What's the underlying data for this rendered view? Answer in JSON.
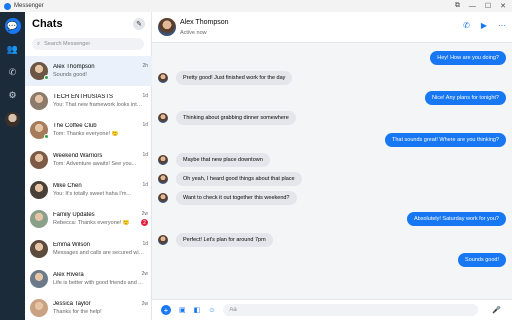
{
  "window": {
    "title": "Messenger",
    "controls": [
      "⧉",
      "—",
      "☐",
      "✕"
    ]
  },
  "sidebar": {
    "title": "Chats",
    "search_placeholder": "Search Messenger"
  },
  "chats": [
    {
      "name": "Alex Thompson",
      "preview": "Sounds good!",
      "time": "2h",
      "selected": true,
      "online": true,
      "avatar": "#6b5544"
    },
    {
      "name": "TECH ENTHUSIASTS",
      "preview": "You: That new framework looks inter...",
      "time": "1d",
      "avatar": "#8c7b6a"
    },
    {
      "name": "The Coffee Club",
      "preview": "Tom: Thanks everyone! 🙂",
      "time": "1d",
      "online": true,
      "avatar": "#a47c5c"
    },
    {
      "name": "Weekend Warriors",
      "preview": "Tom: Adventure awaits! See you...",
      "time": "1d",
      "avatar": "#7d5a45"
    },
    {
      "name": "Mike Chen",
      "preview": "You: It's totally sweet haha I'm...",
      "time": "1d",
      "avatar": "#4a4038"
    },
    {
      "name": "Family Updates",
      "preview": "Rebecca: Thanks everyone! 🙂",
      "time": "2w",
      "badge": "2",
      "avatar": "#8aa08a"
    },
    {
      "name": "Emma Wilson",
      "preview": "Messages and calls are secured with...",
      "time": "1d",
      "avatar": "#5c4a3d"
    },
    {
      "name": "Alex Rivera",
      "preview": "Life is better with good friends and ...",
      "time": "2w",
      "avatar": "#6a7a8a"
    },
    {
      "name": "Jessica Taylor",
      "preview": "Thanks for the help!",
      "time": "2w",
      "avatar": "#c9a283"
    }
  ],
  "conversation": {
    "name": "Alex Thompson",
    "status": "Active now",
    "messages": [
      {
        "dir": "out",
        "text": "Hey! How are you doing?",
        "avatar": false
      },
      {
        "dir": "in",
        "text": "Pretty good! Just finished work for the day",
        "avatar": true
      },
      {
        "dir": "out",
        "text": "Nice! Any plans for tonight?",
        "avatar": false
      },
      {
        "dir": "in",
        "text": "Thinking about grabbing dinner somewhere",
        "avatar": true
      },
      {
        "dir": "out",
        "text": "That sounds great! Where are you thinking?",
        "avatar": false
      },
      {
        "dir": "in",
        "text": "Maybe that new place downtown",
        "avatar": true
      },
      {
        "dir": "in",
        "text": "Oh yeah, I heard good things about that place",
        "avatar": true
      },
      {
        "dir": "in",
        "text": "Want to check it out together this weekend?",
        "avatar": true
      },
      {
        "dir": "out",
        "text": "Absolutely! Saturday work for you?",
        "avatar": false
      },
      {
        "dir": "in",
        "text": "Perfect! Let's plan for around 7pm",
        "avatar": true
      },
      {
        "dir": "out",
        "text": "Sounds good!",
        "avatar": false
      }
    ]
  },
  "composer": {
    "placeholder": "Aa"
  }
}
